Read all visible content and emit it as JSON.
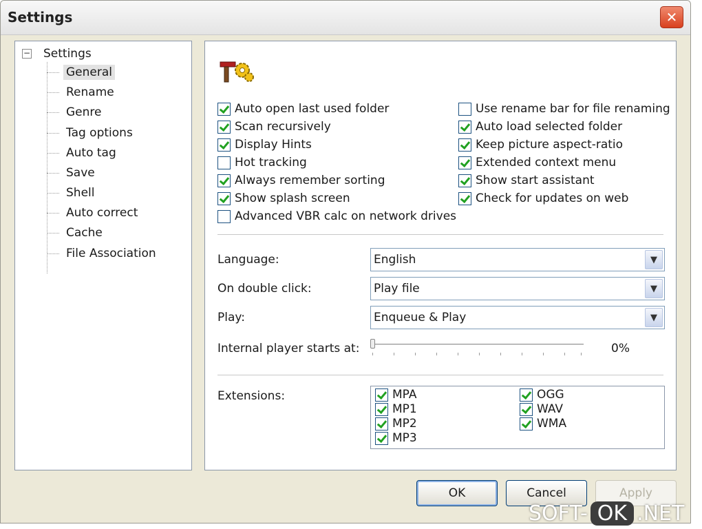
{
  "window": {
    "title": "Settings",
    "close_label": "✕"
  },
  "tree": {
    "root": "Settings",
    "items": [
      {
        "label": "General"
      },
      {
        "label": "Rename"
      },
      {
        "label": "Genre"
      },
      {
        "label": "Tag options"
      },
      {
        "label": "Auto tag"
      },
      {
        "label": "Save"
      },
      {
        "label": "Shell"
      },
      {
        "label": "Auto correct"
      },
      {
        "label": "Cache"
      },
      {
        "label": "File Association"
      }
    ]
  },
  "options": {
    "left": [
      {
        "label": "Auto open last used folder",
        "checked": true
      },
      {
        "label": "Scan recursively",
        "checked": true
      },
      {
        "label": "Display Hints",
        "checked": true
      },
      {
        "label": "Hot tracking",
        "checked": false
      },
      {
        "label": "Always remember sorting",
        "checked": true
      },
      {
        "label": "Show splash screen",
        "checked": true
      },
      {
        "label": "Advanced VBR calc on network drives",
        "checked": false
      }
    ],
    "right": [
      {
        "label": "Use rename bar for file renaming",
        "checked": false
      },
      {
        "label": "Auto load selected folder",
        "checked": true
      },
      {
        "label": "Keep picture aspect-ratio",
        "checked": true
      },
      {
        "label": "Extended context menu",
        "checked": true
      },
      {
        "label": "Show start assistant",
        "checked": true
      },
      {
        "label": "Check for updates on web",
        "checked": true
      }
    ]
  },
  "fields": {
    "language": {
      "label": "Language:",
      "value": "English"
    },
    "double_click": {
      "label": "On double click:",
      "value": "Play file"
    },
    "play": {
      "label": "Play:",
      "value": "Enqueue & Play"
    }
  },
  "player_start": {
    "label": "Internal player starts at:",
    "value": "0%",
    "level": 0
  },
  "extensions": {
    "label": "Extensions:",
    "items": [
      {
        "label": "MPA",
        "checked": true
      },
      {
        "label": "MP1",
        "checked": true
      },
      {
        "label": "MP2",
        "checked": true
      },
      {
        "label": "MP3",
        "checked": true
      },
      {
        "label": "OGG",
        "checked": true
      },
      {
        "label": "WAV",
        "checked": true
      },
      {
        "label": "WMA",
        "checked": true
      }
    ]
  },
  "buttons": {
    "ok": "OK",
    "cancel": "Cancel",
    "apply": "Apply"
  },
  "watermark": {
    "pre": "SOFT-",
    "ok": "OK",
    "post": ".NET"
  },
  "colors": {
    "check": "#21a121",
    "accent": "#003c74",
    "close": "#d8401e"
  }
}
